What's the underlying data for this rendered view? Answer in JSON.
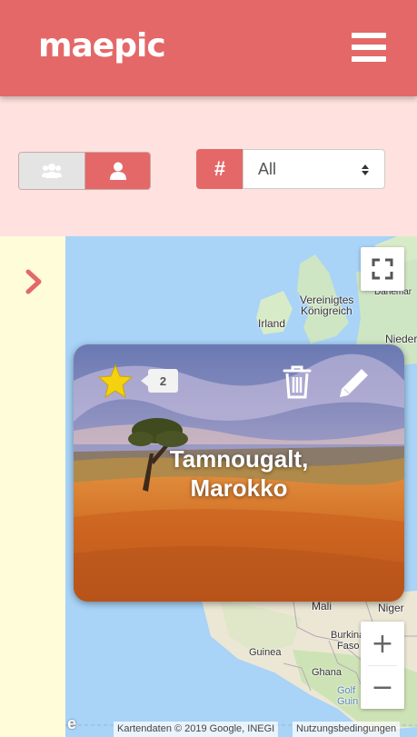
{
  "header": {
    "logo_text": "maepic",
    "menu_icon": "hamburger-menu-icon"
  },
  "filters": {
    "mode_toggle": {
      "options": [
        {
          "icon": "users-icon",
          "selected": false
        },
        {
          "icon": "user-icon",
          "selected": true
        }
      ]
    },
    "hashtag_icon": "hashtag-icon",
    "hashtag_symbol": "#",
    "tag_select": {
      "selected": "All"
    }
  },
  "sidebar": {
    "expand_icon": "chevron-right-icon"
  },
  "map": {
    "labels": {
      "uk": "Vereinigtes Königreich",
      "uk_line2": "Königreich",
      "uk_line1": "Vereinigtes",
      "ireland": "Irland",
      "denmark": "Danemar",
      "netherlands": "Nieder",
      "mali": "Mali",
      "niger": "Niger",
      "burkina_line1": "Burkina",
      "burkina_line2": "Faso",
      "guinea": "Guinea",
      "ghana": "Ghana",
      "gulf_line1": "Golf",
      "gulf_line2": "Guin"
    },
    "attribution": "Kartendaten © 2019 Google, INEGI",
    "terms": "Nutzungsbedingungen",
    "google_fragment": "e",
    "zoom_in": "+",
    "zoom_out": "−"
  },
  "card": {
    "title_line1": "Tamnougalt,",
    "title_line2": "Marokko",
    "favorite_count": "2",
    "colors": {
      "accent": "#e46868",
      "star": "#f5d20f"
    }
  }
}
